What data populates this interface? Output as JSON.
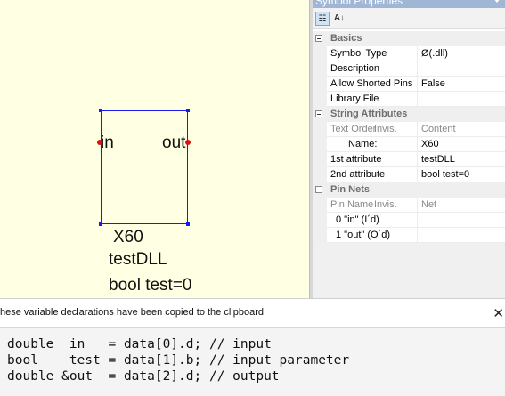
{
  "symbol": {
    "pin_in": "in",
    "pin_out": "out",
    "text_name": "X60",
    "text_attr1": "testDLL",
    "text_attr2": "bool test=0"
  },
  "properties_panel": {
    "title": "Symbol Properties",
    "toolbar": {
      "categorized_icon": "categorized-icon",
      "alphabetical_icon": "sort-az-icon"
    },
    "sections": [
      {
        "label": "Basics",
        "rows": [
          {
            "name": "Symbol Type",
            "value": "Ø(.dll)"
          },
          {
            "name": "Description",
            "value": ""
          },
          {
            "name": "Allow Shorted Pins",
            "value": "False"
          },
          {
            "name": "Library File",
            "value": ""
          }
        ]
      },
      {
        "label": "String Attributes",
        "header": {
          "name": "Text Order",
          "invis": "Invis.",
          "value": "Content"
        },
        "rows": [
          {
            "name": "Name:",
            "value": "X60"
          },
          {
            "name": "1st attribute",
            "value": "testDLL"
          },
          {
            "name": "2nd attribute",
            "value": "bool test=0"
          }
        ]
      },
      {
        "label": "Pin Nets",
        "header": {
          "name": "Pin Name",
          "invis": "Invis.",
          "value": "Net"
        },
        "rows": [
          {
            "name": "0 \"in\" (I´d)",
            "value": ""
          },
          {
            "name": "1 \"out\" (O´d)",
            "value": ""
          }
        ]
      }
    ]
  },
  "notice": {
    "text": "hese variable declarations have been copied to the clipboard.",
    "close": "✕"
  },
  "code": {
    "lines": [
      "double  in   = data[0].d; // input",
      "bool    test = data[1].b; // input parameter",
      "double &out  = data[2].d; // output"
    ]
  }
}
